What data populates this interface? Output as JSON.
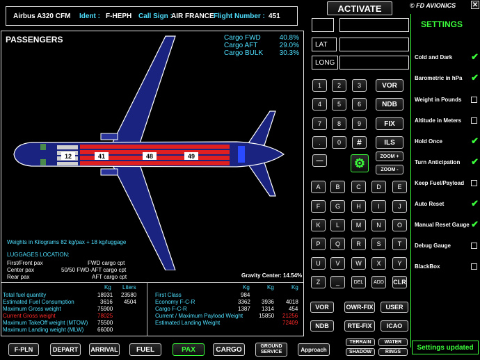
{
  "header": {
    "aircraft": "Airbus A320 CFM",
    "ident_label": "Ident :",
    "ident": "F-HEPH",
    "callsign_label": "Call Sign :",
    "callsign": "AIR FRANCE",
    "flight_label": "Flight Number :",
    "flight": "451"
  },
  "passengers_title": "PASSENGERS",
  "cargo": {
    "fwd_label": "Cargo FWD",
    "fwd": "40.8%",
    "aft_label": "Cargo AFT",
    "aft": "29.0%",
    "bulk_label": "Cargo BULK",
    "bulk": "30.3%"
  },
  "cabin_counts": [
    "12",
    "41",
    "48",
    "49"
  ],
  "weights_note": "Weights in Kilograms  82 kg/pax + 18 kg/luggage",
  "luggage": {
    "title": "LUGGAGES LOCATION:",
    "rows": [
      {
        "label": "First/Front pax",
        "value": "FWD cargo cpt"
      },
      {
        "label": "Center pax",
        "value": "50/50 FWD-AFT cargo cpt"
      },
      {
        "label": "Rear pax",
        "value": "AFT cargo cpt"
      }
    ]
  },
  "gravity_center": "Gravity Center: 14.54%",
  "fuel_table": {
    "headers": [
      "Kg",
      "Liters"
    ],
    "rows": [
      {
        "label": "Total fuel quantity",
        "kg": "18931",
        "liters": "23580"
      },
      {
        "label": "Estimated Fuel Consumption",
        "kg": "3616",
        "liters": "4504"
      },
      {
        "label": "Maximum Gross weight",
        "kg": "75900",
        "liters": ""
      },
      {
        "label": "Current Gross weight",
        "kg": "78025",
        "liters": ""
      },
      {
        "label": "Maximum TakeOff weight (MTOW)",
        "kg": "75500",
        "liters": ""
      },
      {
        "label": "Maximum Landing weight (MLW)",
        "kg": "66000",
        "liters": ""
      }
    ]
  },
  "pax_table": {
    "headers": [
      "Kg",
      "Kg",
      "Kg"
    ],
    "rows": [
      {
        "label": "First Class",
        "a": "984",
        "b": "",
        "c": ""
      },
      {
        "label": "Economy F-C-R",
        "a": "3362",
        "b": "3936",
        "c": "4018"
      },
      {
        "label": "Cargo F-C-R",
        "a": "1387",
        "b": "1314",
        "c": "454"
      },
      {
        "label": "Current / Maximum Payload Weight",
        "a": "",
        "b": "15850",
        "c": "21256"
      },
      {
        "label": "Estimated Landing Weight",
        "a": "",
        "b": "",
        "c": "72409"
      }
    ]
  },
  "bottom_tabs": [
    "F-PLN",
    "DEPART",
    "ARRIVAL",
    "FUEL",
    "PAX",
    "CARGO",
    "GROUND SERVICE",
    "Approach"
  ],
  "mini_buttons": [
    "TERRAIN",
    "WATER",
    "SHADOW",
    "RINGS"
  ],
  "activate": "ACTIVATE",
  "brand": "© FD AVIONICS",
  "lat_label": "LAT",
  "long_label": "LONG",
  "numpad": [
    "1",
    "2",
    "3",
    "4",
    "5",
    "6",
    "7",
    "8",
    "9",
    ".",
    "0",
    "#"
  ],
  "nav_buttons": [
    "VOR",
    "NDB",
    "FIX",
    "ILS"
  ],
  "dash": "—",
  "zoom_plus": "ZOOM +",
  "zoom_minus": "ZOOM -",
  "letters": [
    "A",
    "B",
    "C",
    "D",
    "E",
    "F",
    "G",
    "H",
    "I",
    "J",
    "K",
    "L",
    "M",
    "N",
    "O",
    "P",
    "Q",
    "R",
    "S",
    "T",
    "U",
    "V",
    "W",
    "X",
    "Y"
  ],
  "last_row": [
    "Z",
    "_",
    "DEL",
    "ADD",
    "CLR"
  ],
  "func_buttons": [
    "VOR",
    "OWR-FIX",
    "USER",
    "NDB",
    "RTE-FIX",
    "ICAO"
  ],
  "settings": {
    "title": "SETTINGS",
    "items": [
      {
        "label": "Cold and Dark",
        "checked": true
      },
      {
        "label": "Barometric in hPa",
        "checked": true
      },
      {
        "label": "Weight in Pounds",
        "checked": false
      },
      {
        "label": "Altitude in Meters",
        "checked": false
      },
      {
        "label": "Hold Once",
        "checked": true
      },
      {
        "label": "Turn Anticipation",
        "checked": true
      },
      {
        "label": "Keep Fuel/Payload",
        "checked": false
      },
      {
        "label": "Auto Reset",
        "checked": true
      },
      {
        "label": "Manual Reset Gauge",
        "checked": true
      },
      {
        "label": "Debug Gauge",
        "checked": false
      },
      {
        "label": "BlackBox",
        "checked": false
      }
    ],
    "status": "Settings updated"
  },
  "colors": {
    "accent_green": "#3cff3c",
    "cyan": "#4fe0ff",
    "alert_red": "#ff2a2a",
    "plane_blue": "#1a2480"
  }
}
